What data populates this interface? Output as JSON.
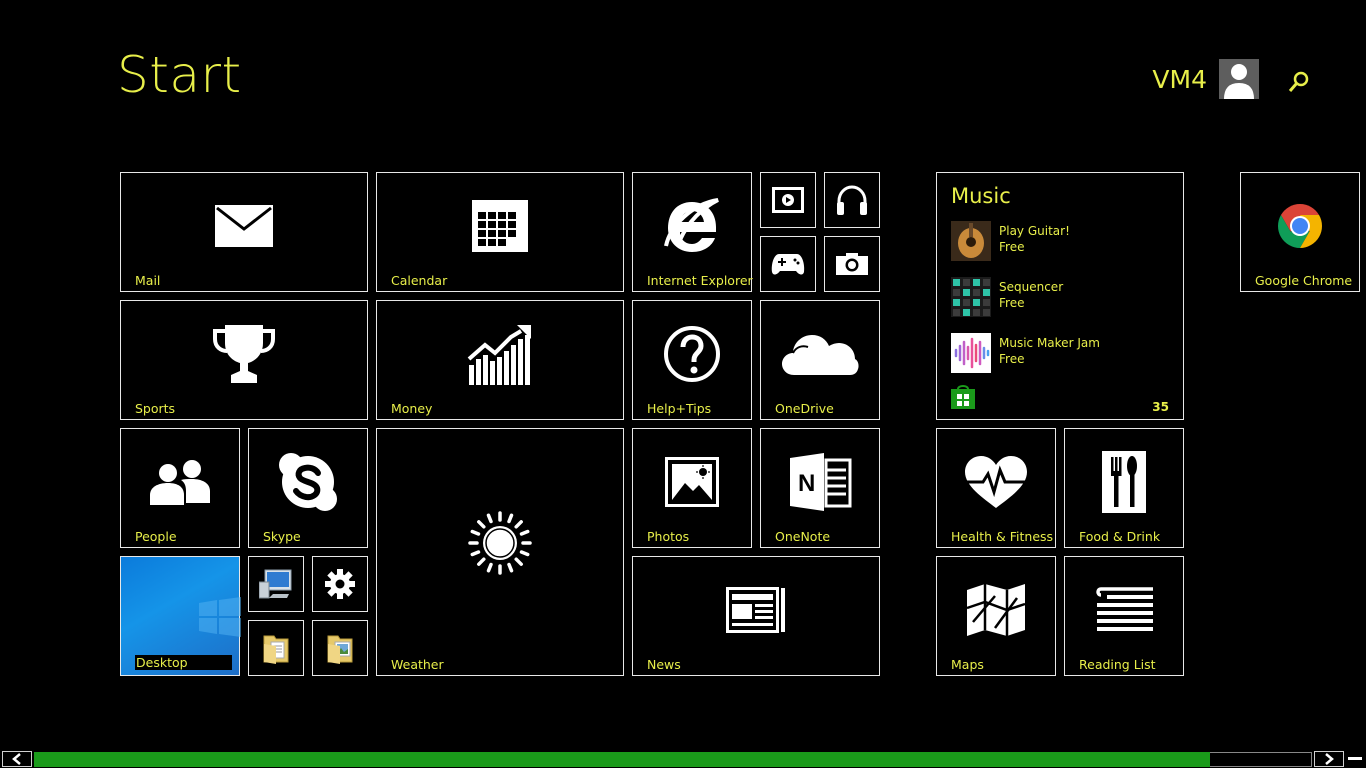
{
  "header": {
    "title": "Start",
    "user_name": "VM4"
  },
  "colors": {
    "accent": "#e8ef4a",
    "background": "#000000",
    "scroll_thumb": "#1a9a1a"
  },
  "tiles": {
    "mail": "Mail",
    "calendar": "Calendar",
    "internet_explorer": "Internet Explorer",
    "sports": "Sports",
    "money": "Money",
    "help_tips": "Help+Tips",
    "onedrive": "OneDrive",
    "people": "People",
    "skype": "Skype",
    "weather": "Weather",
    "photos": "Photos",
    "onenote": "OneNote",
    "desktop": "Desktop",
    "news": "News",
    "google_chrome": "Google Chrome",
    "health_fitness": "Health & Fitness",
    "food_drink": "Food & Drink",
    "maps": "Maps",
    "reading_list": "Reading List"
  },
  "small_tiles": [
    "video-icon",
    "headphones-icon",
    "gamepad-icon",
    "camera-icon",
    "this-pc-icon",
    "settings-gear-icon",
    "folder-documents-icon",
    "folder-pictures-icon"
  ],
  "music": {
    "title": "Music",
    "items": [
      {
        "name": "Play Guitar!",
        "price": "Free"
      },
      {
        "name": "Sequencer",
        "price": "Free"
      },
      {
        "name": "Music Maker Jam",
        "price": "Free"
      }
    ],
    "count": "35"
  },
  "scroll": {
    "position": 0.0,
    "visible_fraction": 0.92
  }
}
